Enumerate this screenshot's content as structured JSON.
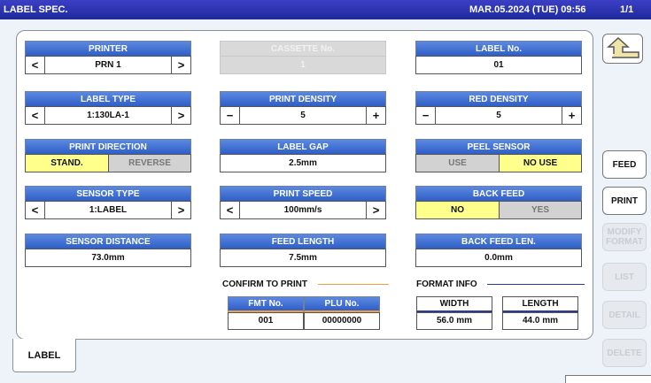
{
  "titlebar": {
    "app": "LABEL SPEC.",
    "datetime": "MAR.05.2024 (TUE) 09:56",
    "page": "1/1"
  },
  "fields": {
    "printer": {
      "label": "PRINTER",
      "value": "PRN 1"
    },
    "cassette": {
      "label": "CASSETTE No.",
      "value": "1"
    },
    "label_no": {
      "label": "LABEL No.",
      "value": "01"
    },
    "label_type": {
      "label": "LABEL TYPE",
      "value": "1:130LA-1"
    },
    "print_density": {
      "label": "PRINT DENSITY",
      "value": "5"
    },
    "red_density": {
      "label": "RED DENSITY",
      "value": "5"
    },
    "print_direction": {
      "label": "PRINT DIRECTION",
      "opt_a": "STAND.",
      "opt_b": "REVERSE",
      "selected": "STAND."
    },
    "label_gap": {
      "label": "LABEL GAP",
      "value": "2.5mm"
    },
    "peel_sensor": {
      "label": "PEEL SENSOR",
      "opt_a": "USE",
      "opt_b": "NO USE",
      "selected": "NO USE"
    },
    "sensor_type": {
      "label": "SENSOR TYPE",
      "value": "1:LABEL"
    },
    "print_speed": {
      "label": "PRINT SPEED",
      "value": "100mm/s"
    },
    "back_feed": {
      "label": "BACK FEED",
      "opt_a": "NO",
      "opt_b": "YES",
      "selected": "NO"
    },
    "sensor_distance": {
      "label": "SENSOR DISTANCE",
      "value": "73.0mm"
    },
    "feed_length": {
      "label": "FEED LENGTH",
      "value": "7.5mm"
    },
    "back_feed_len": {
      "label": "BACK FEED LEN.",
      "value": "0.0mm"
    }
  },
  "confirm": {
    "label": "CONFIRM TO PRINT",
    "fmt_label": "FMT No.",
    "fmt_value": "001",
    "plu_label": "PLU No.",
    "plu_value": "00000000"
  },
  "format_info": {
    "label": "FORMAT INFO",
    "width_label": "WIDTH",
    "width_value": "56.0 mm",
    "length_label": "LENGTH",
    "length_value": "44.0 mm"
  },
  "side": {
    "feed": "FEED",
    "print": "PRINT",
    "modify_1": "MODIFY",
    "modify_2": "FORMAT",
    "list": "LIST",
    "detail": "DETAIL",
    "delete": "DELETE"
  },
  "tab": {
    "label": "LABEL"
  },
  "icons": {
    "back": "return-arrow-icon",
    "left": "chevron-left-icon",
    "right": "chevron-right-icon",
    "minus": "minus-icon",
    "plus": "plus-icon"
  },
  "colors": {
    "titlebar": "#2a34b0",
    "header_blue": "#3d6fd6",
    "selected": "#ffff8c",
    "confirm_line": "#f0a040",
    "format_line": "#2b3a9e"
  }
}
